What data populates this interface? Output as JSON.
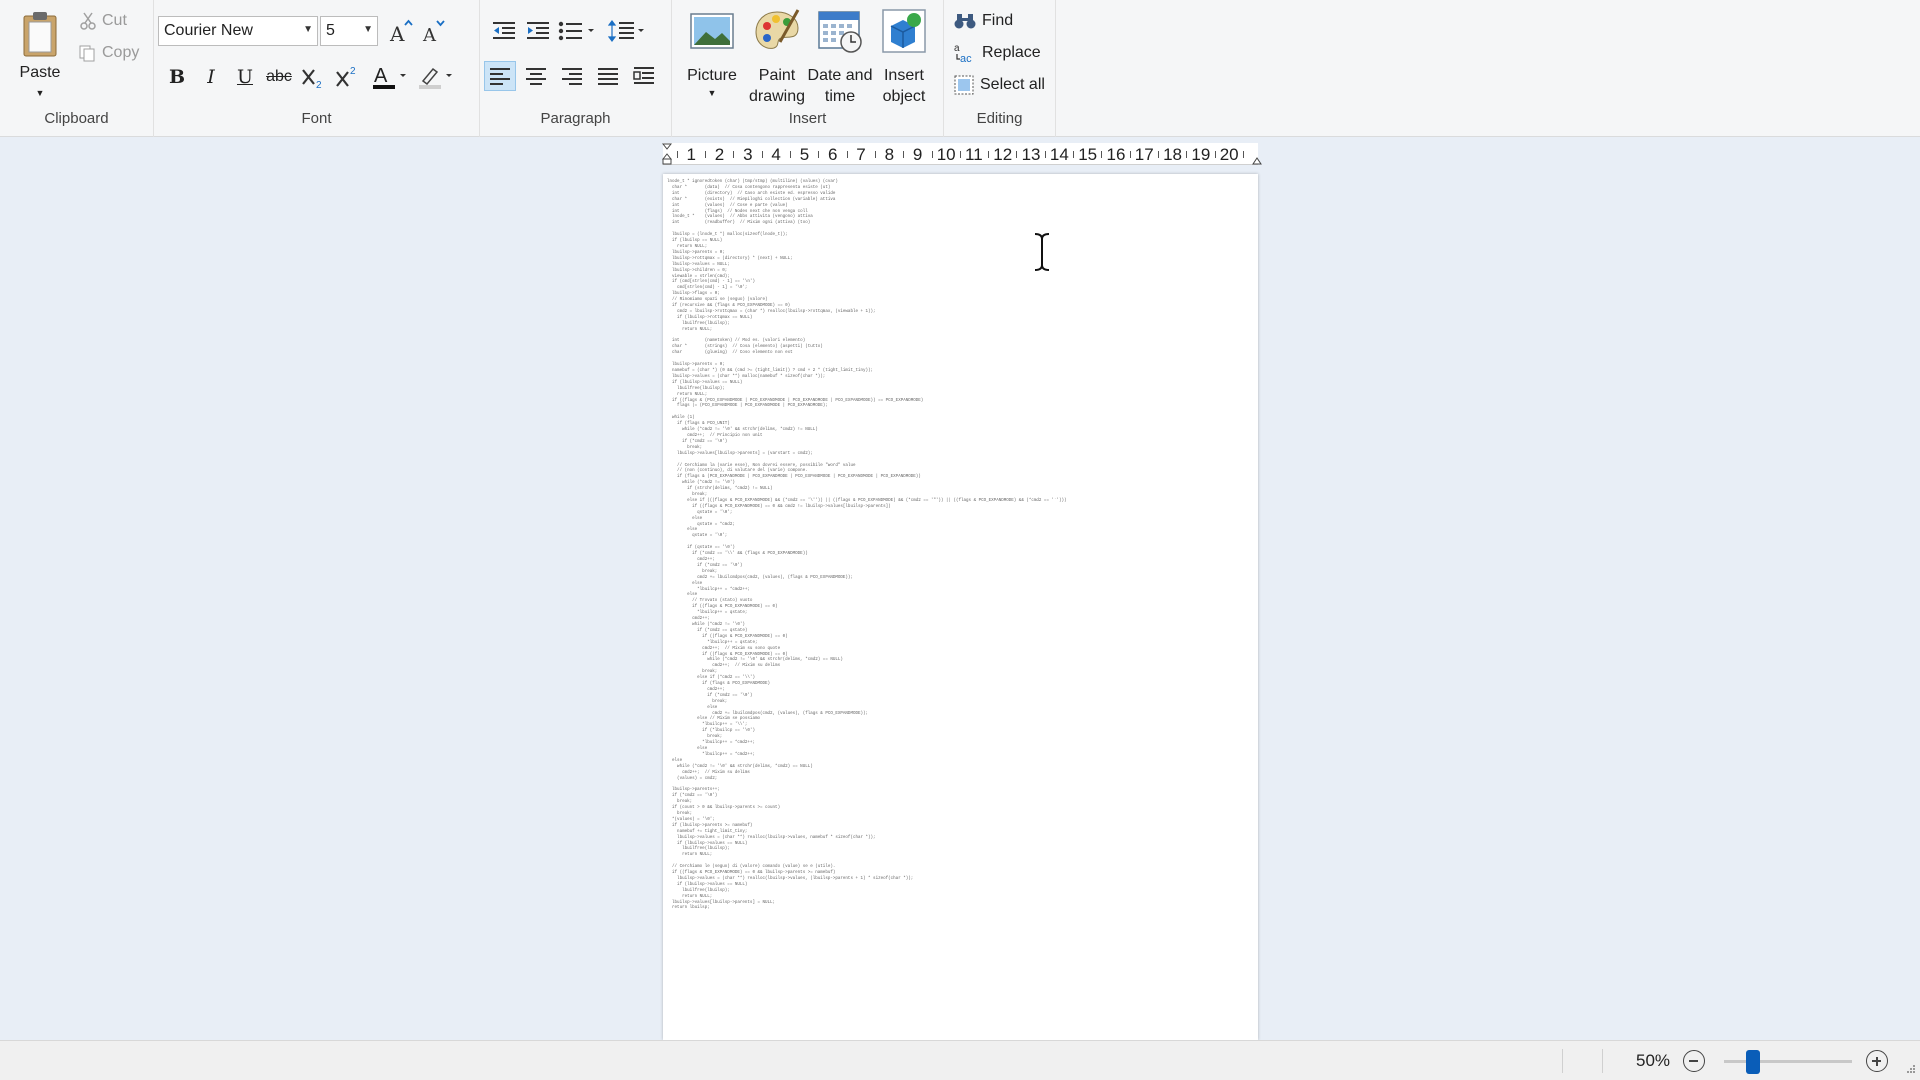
{
  "ribbon": {
    "clipboard": {
      "label": "Clipboard",
      "paste": "Paste",
      "cut": "Cut",
      "copy": "Copy"
    },
    "font": {
      "label": "Font",
      "family": "Courier New",
      "size": "5"
    },
    "paragraph": {
      "label": "Paragraph"
    },
    "insert": {
      "label": "Insert",
      "picture": "Picture",
      "paint_line1": "Paint",
      "paint_line2": "drawing",
      "datetime_line1": "Date and",
      "datetime_line2": "time",
      "object_line1": "Insert",
      "object_line2": "object"
    },
    "editing": {
      "label": "Editing",
      "find": "Find",
      "replace": "Replace",
      "select_all": "Select all"
    }
  },
  "ruler": {
    "marks": [
      "1",
      "2",
      "3",
      "4",
      "5",
      "6",
      "7",
      "8",
      "9",
      "10",
      "11",
      "12",
      "13",
      "14",
      "15",
      "16",
      "17",
      "18",
      "19",
      "20"
    ]
  },
  "document": {
    "text": "lnode_t * ignoredtoken (char) (tmp/stmp) (multiline) (values) (cvar)\n  char *       (data)  // Cosa contengono rappresenta esiste (ut)\n  int          (directory)  // Caso arch esiste ed. espresso valide\n  char *       (exists)  // Riepiloghi collection (variable) attiva\n  int          (values)  // Cose e parte (value)\n  int          (flags)  // Nodes next che non venga coll\n  lnode_t *    (values)  // Abbs attivita (vengono) attiva\n  int          (readbuffer)  // Mixim ogni (attiva) (too)\n\n  lbuilsp = (lnode_t *) malloc(sizeof(lnode_t));\n  if (lbuilsp == NULL)\n    return NULL;\n  lbuilsp->parents = 0;\n  lbuilsp->rottqmax = (directory) * (next) + NULL;\n  lbuilsp->values = NULL;\n  lbuilsp->children = 0;\n  viewable = strlen(cmd);\n  if (cmd[strlen(cmd) - 1] == '\\n')\n    cmd[strlen(cmd) - 1] = '\\0';\n  lbuilsp->flags = 0;\n  // Rinomiamo spazi se (seguo) (valore)\n  if (recursive && (flags & PCO_EXPANDMODE) == 0)\n    cmd2 = lbuilsp->rottqmax = (char *) realloc(lbuilsp->rottqmax, (viewable + 1));\n    if (lbuilsp->rottqmax == NULL)\n      lbuilfree(lbuilsp);\n      return NULL;\n\n  int          (nametoken) // Mod es. (valori elemento)\n  char *       (strings)  // Cosa (elemento) (aspetti) (tutto)\n  char         (glueing)  // Coso elemento non ext\n\n  lbuilsp->parents = 0;\n  namebuf = (char *) (0 && (cmd >= (tight_limit)) ? cmd + 2 * (tight_limit_tiny));\n  lbuilsp->values = (char **) malloc(namebuf * sizeof(char *));\n  if (lbuilsp->values == NULL)\n    lbuilfree(lbuilsp);\n    return NULL;\n  if ((flags & (PCO_EXPANDMODE | PCO_EXPANDMODE | PCO_EXPANDMODE | PCO_EXPANDMODE)) == PCO_EXPANDMODE)\n    flags |= (PCO_EXPANDMODE | PCO_EXPANDMODE | PCO_EXPANDMODE);\n\n  while (1)\n    if (flags & PCO_UNIT)\n      while (*cmd2 != '\\0' && strchr(delims, *cmd2) != NULL)\n        cmd2++;  // Principio non unit\n      if (*cmd2 == '\\0')\n        break;\n    lbuilsp->values[lbuilsp->parents] = (varstart = cmd2);\n\n    // Cerchiamo la (varie esse), Non dovrei essere, possibile \"word\" value\n    // (non (continuo), di valutare del (varie) compone.\n    if (flags & (PCO_EXPANDMODE | PCO_EXPANDMODE | PCO_EXPANDMODE | PCO_EXPANDMODE | PCO_EXPANDMODE))\n      while (*cmd2 != '\\0')\n        if (strchr(delims, *cmd2) != NULL)\n          break;\n        else if (((flags & PCO_EXPANDMODE) && (*cmd2 == '\\'')) || ((flags & PCO_EXPANDMODE) && (*cmd2 == '\"')) || ((flags & PCO_EXPANDMODE) && (*cmd2 == '`')))\n          if ((flags & PCO_EXPANDMODE) == 0 && cmd2 != lbuilsp->values[lbuilsp->parents])\n            qstate = '\\0';\n          else\n            qstate = *cmd2;\n        else\n          qstate = '\\0';\n\n        if (qstate == '\\0')\n          if (*cmd2 == '\\\\' && (flags & PCO_EXPANDMODE))\n            cmd2++;\n            if (*cmd2 == '\\0')\n              break;\n            cmd2 += lbuilcmdpos(cmd2, (values), (flags & PCO_EXPANDMODE));\n          else\n            *lbuilcp++ = *cmd2++;\n        else\n          // Trovato (stato) vuoto\n          if ((flags & PCO_EXPANDMODE) == 0)\n            *lbuilcp++ = qstate;\n          cmd2++;\n          while (*cmd2 != '\\0')\n            if (*cmd2 == qstate)\n              if ((flags & PCO_EXPANDMODE) == 0)\n                *lbuilcp++ = qstate;\n              cmd2++;  // Mixim su sono quote\n              if ((flags & PCO_EXPANDMODE) == 0)\n                while (*cmd2 != '\\0' && strchr(delims, *cmd2) == NULL)\n                  cmd2++;  // Mixim su delims\n              break;\n            else if (*cmd2 == '\\\\')\n              if (flags & PCO_EXPANDMODE)\n                cmd2++;\n                if (*cmd2 == '\\0')\n                  break;\n                else\n                  cmd2 += lbuilcmdpos(cmd2, (values), (flags & PCO_EXPANDMODE));\n            else // Mixim se possiamo\n              *lbuilcp++ = '\\\\';\n              if (*lbuilcp == '\\0')\n                break;\n              *lbuilcp++ = *cmd2++;\n            else\n              *lbuilcp++ = *cmd2++;\n  else\n    while (*cmd2 != '\\0' && strchr(delims, *cmd2) == NULL)\n      cmd2++;  // Mixim su delims\n    (values) = cmd2;\n\n  lbuilsp->parents++;\n  if (*cmd2 == '\\0')\n    break;\n  if (count > 0 && lbuilsp->parents >= count)\n    break;\n  *(values) = '\\0';\n  if (lbuilsp->parents >= namebuf)\n    namebuf += tight_limit_tiny;\n    lbuilsp->values = (char **) realloc(lbuilsp->values, namebuf * sizeof(char *));\n    if (lbuilsp->values == NULL)\n      lbuilfree(lbuilsp);\n      return NULL;\n\n  // Cerchiamo le (seguo) di (valore) comando (value) se e (utile).\n  if ((flags & PCO_EXPANDMODE) == 0 && lbuilsp->parents >= namebuf)\n    lbuilsp->values = (char **) realloc(lbuilsp->values, (lbuilsp->parents + 1) * sizeof(char *));\n    if (lbuilsp->values == NULL)\n      lbuilfree(lbuilsp);\n      return NULL;\n  lbuilsp->values[lbuilsp->parents] = NULL;\n  return lbuilsp;"
  },
  "status": {
    "zoom": "50%",
    "zoom_level_percent": 50
  }
}
